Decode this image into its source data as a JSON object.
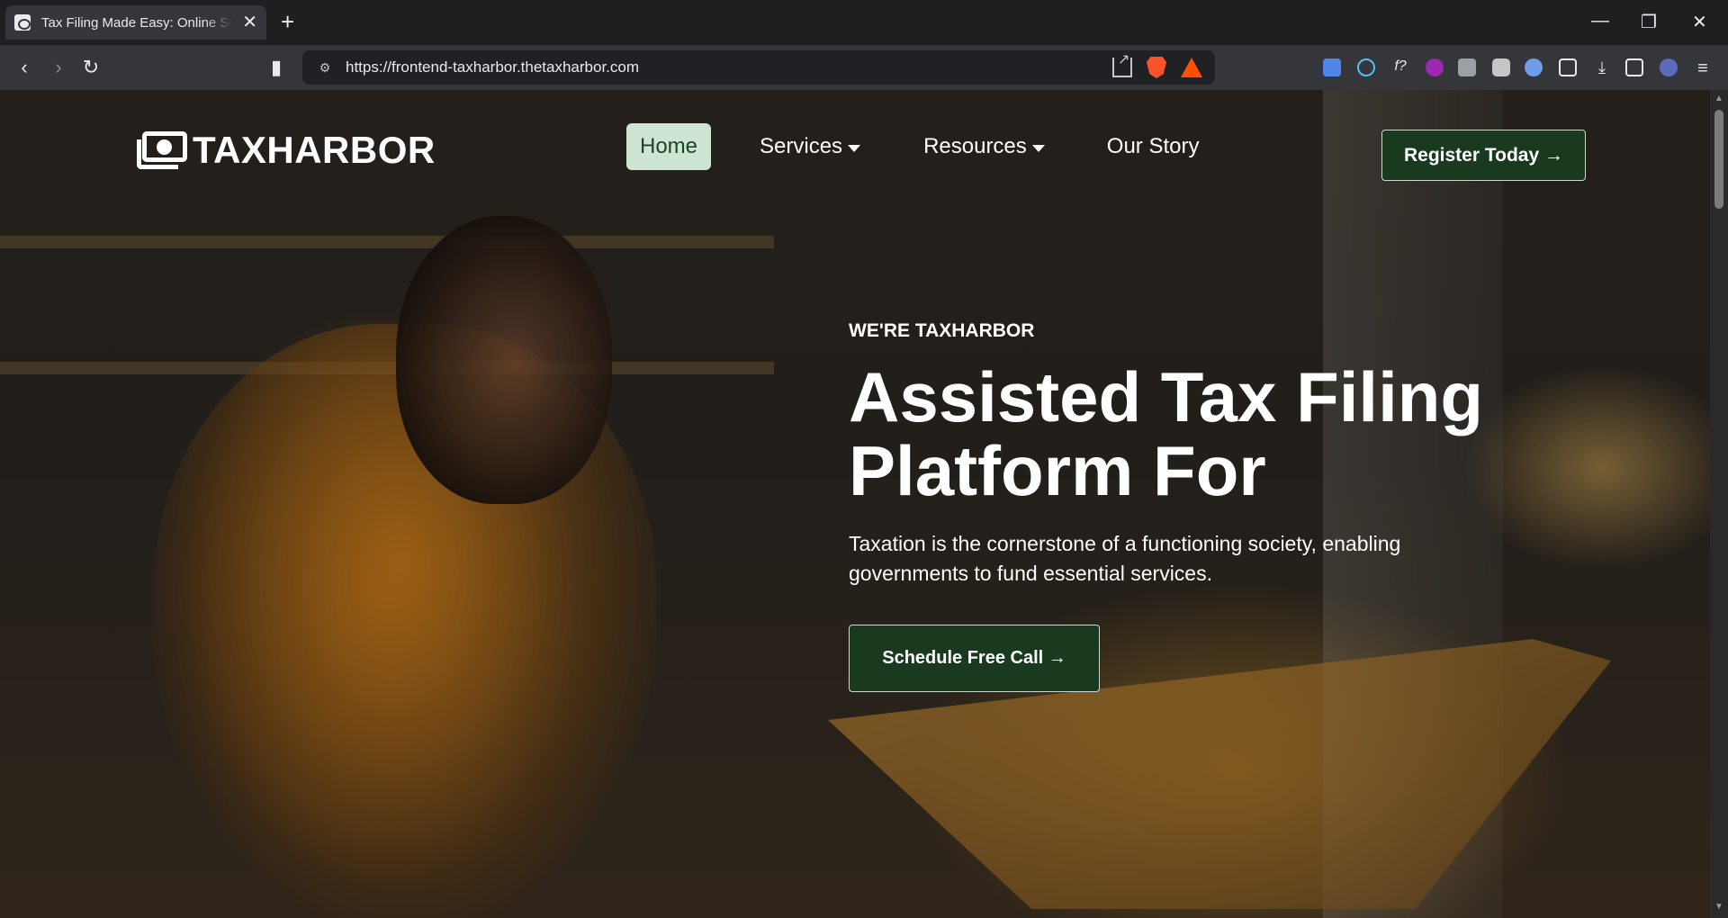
{
  "browser": {
    "tab_title": "Tax Filing Made Easy: Online Solutions",
    "new_tab": "+",
    "tab_close": "✕",
    "url": "https://frontend-taxharbor.thetaxharbor.com",
    "window_controls": {
      "minimize": "—",
      "maximize": "❐",
      "close": "✕"
    }
  },
  "site": {
    "brand": "TAXHARBOR",
    "nav": [
      {
        "label": "Home",
        "active": true
      },
      {
        "label": "Services",
        "dropdown": true
      },
      {
        "label": "Resources",
        "dropdown": true
      },
      {
        "label": "Our Story"
      }
    ],
    "register_button": "Register Today →"
  },
  "hero": {
    "eyebrow": "WE'RE TAXHARBOR",
    "headline_line1": "Assisted Tax Filing",
    "headline_line2": "Platform For",
    "subtext": "Taxation is the cornerstone of a functioning society, enabling governments to fund essential services.",
    "cta": "Schedule Free Call →"
  },
  "colors": {
    "primary_button": "#193a1e",
    "active_nav_bg": "#cfe5d3",
    "active_nav_text": "#1d4427"
  }
}
